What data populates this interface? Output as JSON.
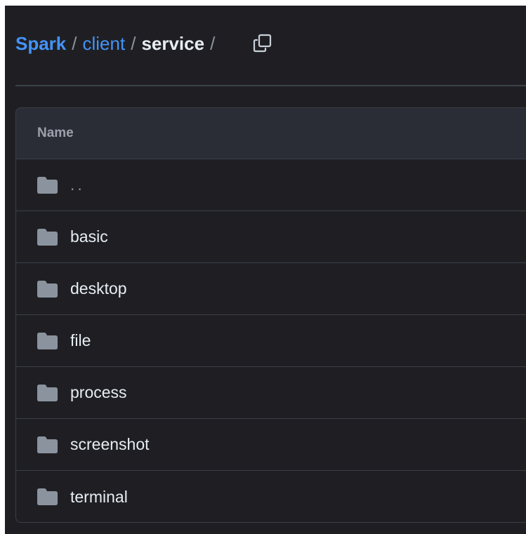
{
  "breadcrumb": {
    "root": "Spark",
    "items": [
      "client"
    ],
    "current": "service",
    "separator": "/",
    "trailing_separator": "/"
  },
  "copy_icon": "copy-icon",
  "table": {
    "header": "Name",
    "rows": [
      {
        "label": "..",
        "icon": "folder-icon"
      },
      {
        "label": "basic",
        "icon": "folder-icon"
      },
      {
        "label": "desktop",
        "icon": "folder-icon"
      },
      {
        "label": "file",
        "icon": "folder-icon"
      },
      {
        "label": "process",
        "icon": "folder-icon"
      },
      {
        "label": "screenshot",
        "icon": "folder-icon"
      },
      {
        "label": "terminal",
        "icon": "folder-icon"
      }
    ]
  },
  "colors": {
    "background": "#1f1f23",
    "link": "#4493f8",
    "text": "#e6edf3",
    "muted": "#9ba1aa",
    "header_bg": "#2b2d36",
    "border": "#3a3f47",
    "folder": "#8b949e"
  }
}
